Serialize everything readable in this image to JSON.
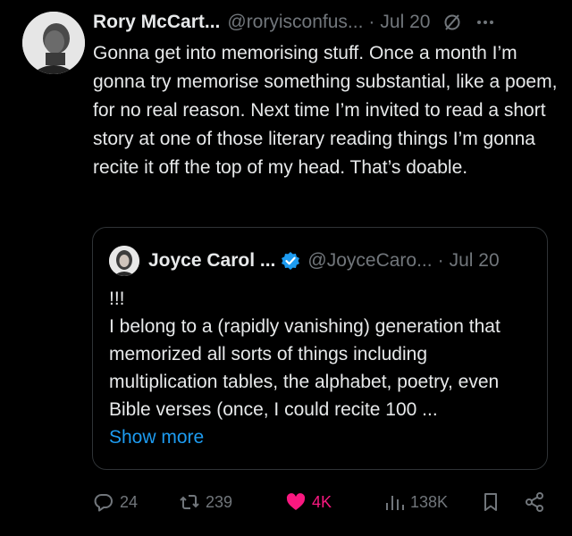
{
  "tweet": {
    "author_name": "Rory McCart...",
    "handle": "@roryisconfus...",
    "separator": "·",
    "date": "Jul 20",
    "text": "Gonna get into memorising stuff. Once a month I’m gonna try memorise something substantial, like a poem, for no real reason. Next time I’m invited to read a short story at one of those literary reading things I’m gonna recite it off the top of my head. That’s doable."
  },
  "quote": {
    "author_name": "Joyce Carol ...",
    "handle": "@JoyceCaro...",
    "separator": "·",
    "date": "Jul 20",
    "text_line1": "!!!",
    "text_body": "I belong to a (rapidly vanishing) generation that memorized all sorts of things including multiplication tables, the alphabet, poetry, even Bible verses (once, I could recite 100 ...",
    "show_more": "Show more"
  },
  "actions": {
    "replies": "24",
    "reposts": "239",
    "likes": "4K",
    "views": "138K"
  },
  "icons": {
    "grok": "slashed-circle-icon",
    "more": "more-dots-icon",
    "verified": "verified-badge-icon",
    "reply": "reply-bubble-icon",
    "repost": "repost-icon",
    "like": "heart-icon",
    "views": "views-bars-icon",
    "bookmark": "bookmark-icon",
    "share": "share-icon"
  },
  "colors": {
    "background": "#000000",
    "text": "#e7e9ea",
    "muted": "#71767b",
    "link": "#1d9bf0",
    "like": "#f91880",
    "verified": "#1d9bf0"
  }
}
